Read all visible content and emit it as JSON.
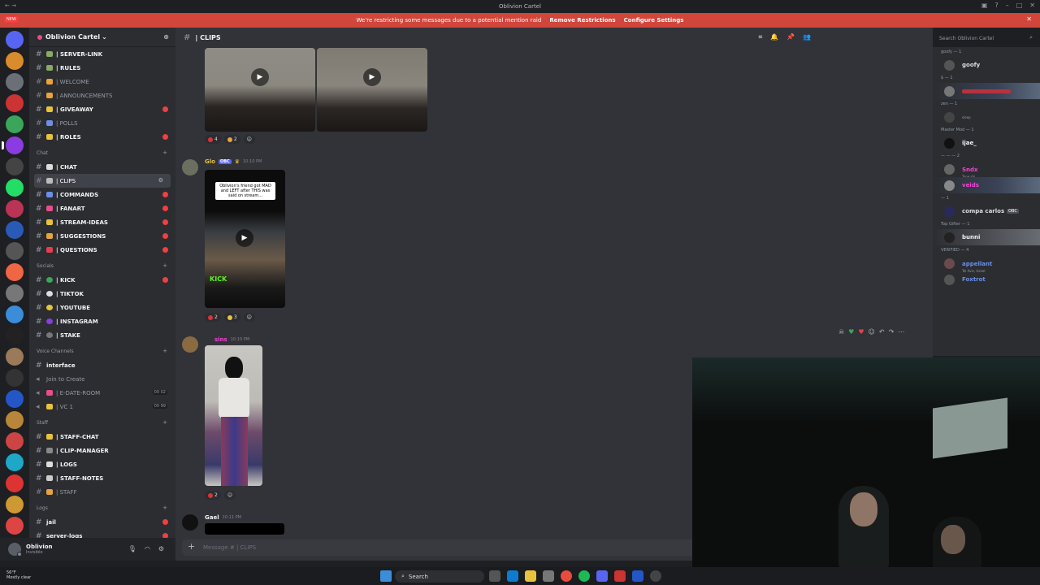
{
  "window": {
    "title": "Oblivion Cartel"
  },
  "notice": {
    "badge": "NEW",
    "text": "We're restricting some messages due to a potential mention raid",
    "link1": "Remove Restrictions",
    "link2": "Configure Settings"
  },
  "server": {
    "name": "Oblivion Cartel"
  },
  "channels": [
    {
      "label": "| SERVER-LINK",
      "icon": "#82a"
    },
    {
      "label": "| RULES",
      "icon": "#8a6"
    },
    {
      "label": "| WELCOME",
      "icon": "#e8a33d"
    },
    {
      "label": "| ANNOUNCEMENTS",
      "icon": "#e8a33d"
    },
    {
      "label": "| GIVEAWAY",
      "icon": "#e8c33d"
    },
    {
      "label": "| POLLS",
      "icon": "#6b8ee8"
    },
    {
      "label": "| ROLES",
      "icon": "#e8c33d"
    }
  ],
  "cat_chat": "Chat",
  "chat_channels": [
    {
      "label": "| CHAT"
    },
    {
      "label": "| CLIPS"
    },
    {
      "label": "| COMMANDS"
    },
    {
      "label": "| FANART"
    },
    {
      "label": "| STREAM-IDEAS"
    },
    {
      "label": "| SUGGESTIONS"
    },
    {
      "label": "| QUESTIONS"
    }
  ],
  "cat_socials": "Socials",
  "social_channels": [
    {
      "label": "| KICK"
    },
    {
      "label": "| TIKTOK"
    },
    {
      "label": "| YOUTUBE"
    },
    {
      "label": "| INSTAGRAM"
    },
    {
      "label": "| STAKE"
    }
  ],
  "cat_voice": "Voice Channels",
  "voice_channels": [
    {
      "label": "interface"
    },
    {
      "label": "Join to Create"
    },
    {
      "label": "| E-DATE-ROOM",
      "count": "00 02"
    },
    {
      "label": "| VC 1",
      "count": "00 99"
    }
  ],
  "cat_staff": "Staff",
  "staff_channels": [
    {
      "label": "| STAFF-CHAT"
    },
    {
      "label": "| CLIP-MANAGER"
    },
    {
      "label": "| LOGS"
    },
    {
      "label": "| STAFF-NOTES"
    },
    {
      "label": "| STAFF"
    }
  ],
  "cat_logs": "Logs",
  "log_channels": [
    {
      "label": "jail"
    },
    {
      "label": "server-logs"
    }
  ],
  "user": {
    "name": "Oblivion",
    "status": "Invisible"
  },
  "channel_header": {
    "name": "| CLIPS"
  },
  "search": {
    "placeholder": "Search Oblivion Cartel"
  },
  "messages": {
    "m1_reactions": [
      "4",
      "2"
    ],
    "m2_author": "Glo",
    "m2_tag": "OBC",
    "m2_time": "10:10 PM",
    "m2_caption": "Oblivion's friend got MAD and LEFT after THIS was said on stream...",
    "m2_watermark": "KICK",
    "m2_reactions": [
      "2",
      "3"
    ],
    "m3_author": "sins",
    "m3_time": "10:10 PM",
    "m3_reactions": [
      "2"
    ],
    "m4_author": "Gael",
    "m4_time": "10:11 PM"
  },
  "composer": {
    "placeholder": "Message #    | CLIPS"
  },
  "members": {
    "groups": [
      {
        "label": "goofy — 1",
        "rows": [
          {
            "name": "goofy",
            "color": "#dbdee1"
          }
        ]
      },
      {
        "label": "$ — 1",
        "rows": [
          {
            "name": "",
            "color": "#e83d4d"
          }
        ]
      },
      {
        "label": "zen — 1",
        "rows": [
          {
            "name": "",
            "sub": "sleep",
            "color": "#dbdee1"
          }
        ]
      },
      {
        "label": "Master Mod — 1",
        "rows": [
          {
            "name": "ijae_",
            "color": "#f2f3f5"
          }
        ]
      },
      {
        "label": "— — — 2",
        "rows": [
          {
            "name": "Sndx",
            "sub": "Type shi",
            "color": "#ee45d3"
          },
          {
            "name": "veids",
            "color": "#ee45d3"
          }
        ]
      },
      {
        "label": "— 1",
        "rows": [
          {
            "name": "compa carlos",
            "tag": "OBC",
            "color": "#dbdee1"
          }
        ]
      },
      {
        "label": "Top Gifter — 1",
        "rows": [
          {
            "name": "bunni",
            "color": "#f2f3f5"
          }
        ]
      },
      {
        "label": "VERIFIED — 4",
        "rows": [
          {
            "name": "appellant",
            "sub": "Tel Aviv, Israel",
            "color": "#6b8ee8"
          },
          {
            "name": "Foxtrot",
            "color": "#6b8ee8"
          }
        ]
      }
    ]
  },
  "taskbar": {
    "weather_temp": "56°F",
    "weather_desc": "Mostly clear",
    "search_label": "Search"
  },
  "colors": {
    "accent": "#5865f2",
    "notice_bg": "#d1453b",
    "unread_badge": "#f23f42"
  }
}
